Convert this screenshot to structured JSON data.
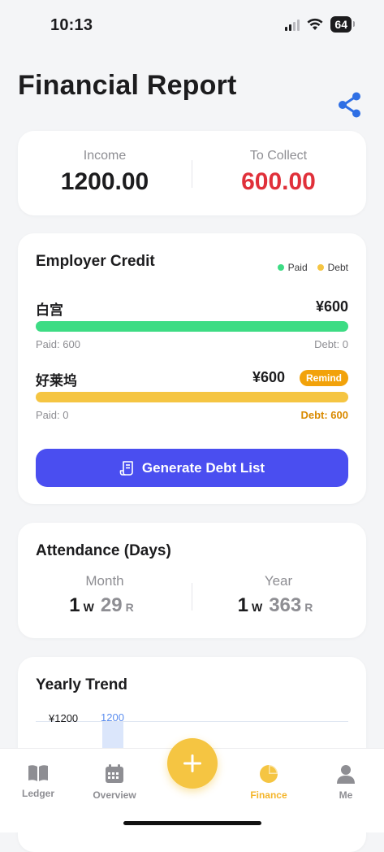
{
  "status_bar": {
    "time": "10:13",
    "battery": "64"
  },
  "header": {
    "title": "Financial Report"
  },
  "summary": {
    "income_label": "Income",
    "income_value": "1200.00",
    "collect_label": "To Collect",
    "collect_value": "600.00"
  },
  "employer_credit": {
    "title": "Employer Credit",
    "legend": [
      {
        "label": "Paid",
        "color": "#3ddc84"
      },
      {
        "label": "Debt",
        "color": "#f5c542"
      }
    ],
    "employers": [
      {
        "name": "白宫",
        "amount": "¥600",
        "paid_label": "Paid: 600",
        "debt_label": "Debt: 0",
        "paid_fraction": 1.0,
        "remind": ""
      },
      {
        "name": "好莱坞",
        "amount": "¥600",
        "paid_label": "Paid: 0",
        "debt_label": "Debt: 600",
        "paid_fraction": 0.0,
        "remind": "Remind"
      }
    ],
    "generate_button": "Generate Debt List"
  },
  "attendance": {
    "title": "Attendance (Days)",
    "month": {
      "label": "Month",
      "w_value": "1",
      "w_unit": "W",
      "r_value": "29",
      "r_unit": "R"
    },
    "year": {
      "label": "Year",
      "w_value": "1",
      "w_unit": "W",
      "r_value": "363",
      "r_unit": "R"
    }
  },
  "yearly_trend": {
    "title": "Yearly Trend",
    "y_tick": "¥1200",
    "bar_label": "1200"
  },
  "tabbar": {
    "tabs": [
      {
        "label": "Ledger",
        "icon": "book-icon"
      },
      {
        "label": "Overview",
        "icon": "calendar-icon"
      },
      {
        "label": "Finance",
        "icon": "pie-chart-icon",
        "active": true
      },
      {
        "label": "Me",
        "icon": "person-icon"
      }
    ],
    "add_icon": "plus-icon"
  },
  "colors": {
    "accent_blue": "#4a4ef0",
    "paid_green": "#3ddc84",
    "debt_yellow": "#f5c542",
    "collect_red": "#e0303a",
    "debt_orange": "#d98a00"
  }
}
